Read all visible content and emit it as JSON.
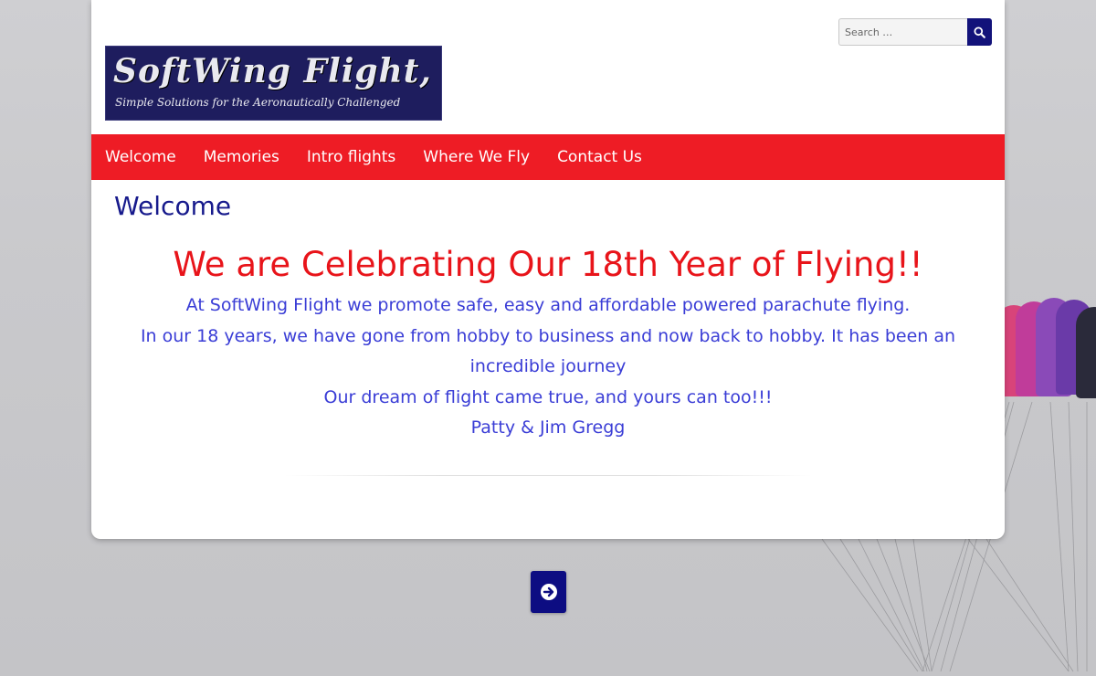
{
  "logo": {
    "title": "SoftWing Flight, LLC.",
    "tagline": "Simple Solutions for the Aeronautically Challenged"
  },
  "search": {
    "placeholder": "Search …",
    "button_icon": "search-icon"
  },
  "nav": {
    "items": [
      {
        "label": "Welcome"
      },
      {
        "label": "Memories"
      },
      {
        "label": "Intro flights"
      },
      {
        "label": "Where We Fly"
      },
      {
        "label": "Contact Us"
      }
    ]
  },
  "main": {
    "page_title": "Welcome",
    "headline": "We are Celebrating Our 18th Year of Flying!!",
    "paragraphs": [
      "At SoftWing Flight we promote safe, easy and affordable powered parachute flying.",
      "In our 18 years, we have gone from hobby to business and now back to hobby.  It has been an incredible journey",
      "Our dream of flight came true, and yours can too!!!",
      "Patty & Jim Gregg"
    ]
  },
  "next_button": {
    "icon": "arrow-circle-right-icon"
  },
  "colors": {
    "nav_bar": "#ee1c25",
    "headline": "#e8141a",
    "body_text": "#3a3dd6",
    "title_text": "#171a8c",
    "button": "#0d0d82",
    "logo_bg": "#1e1d5e"
  }
}
